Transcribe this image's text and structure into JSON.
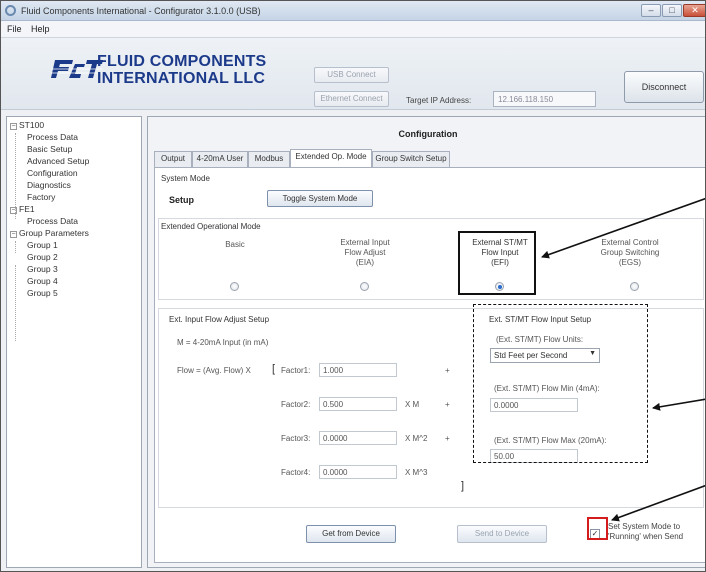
{
  "window": {
    "title": "Fluid Components International - Configurator 3.1.0.0 (USB)",
    "minimize_glyph": "–",
    "maximize_glyph": "□",
    "close_glyph": "✕"
  },
  "menu": {
    "items": [
      "File",
      "Help"
    ]
  },
  "header": {
    "logo_line1": "FLUID COMPONENTS",
    "logo_line2": "INTERNATIONAL LLC",
    "usb_connect": "USB Connect",
    "ethernet_connect": "Ethernet Connect",
    "target_ip_label": "Target IP Address:",
    "target_ip_value": "12.166.118.150",
    "disconnect": "Disconnect"
  },
  "tree": {
    "items": [
      {
        "label": "ST100",
        "expander": "−"
      },
      {
        "label": "Process Data"
      },
      {
        "label": "Basic Setup"
      },
      {
        "label": "Advanced Setup"
      },
      {
        "label": "Configuration"
      },
      {
        "label": "Diagnostics"
      },
      {
        "label": "Factory"
      },
      {
        "label": "FE1",
        "expander": "−"
      },
      {
        "label": "Process Data"
      },
      {
        "label": "Group Parameters",
        "expander": "−"
      },
      {
        "label": "Group 1"
      },
      {
        "label": "Group 2"
      },
      {
        "label": "Group 3"
      },
      {
        "label": "Group 4"
      },
      {
        "label": "Group 5"
      }
    ]
  },
  "config": {
    "title": "Configuration",
    "tabs": [
      "Output",
      "4-20mA User",
      "Modbus",
      "Extended Op. Mode",
      "Group Switch Setup"
    ],
    "active_tab": "Extended Op. Mode",
    "system_mode": {
      "group_label": "System Mode",
      "value": "Setup",
      "toggle_button": "Toggle System Mode"
    },
    "ext_op_mode": {
      "group_label": "Extended Operational Mode",
      "options": [
        {
          "line1": "Basic",
          "line2": "",
          "line3": "",
          "selected": false
        },
        {
          "line1": "External Input",
          "line2": "Flow Adjust",
          "line3": "(EIA)",
          "selected": false
        },
        {
          "line1": "External ST/MT",
          "line2": "Flow Input",
          "line3": "(EFI)",
          "selected": true
        },
        {
          "line1": "External Control",
          "line2": "Group Switching",
          "line3": "(EGS)",
          "selected": false
        }
      ]
    },
    "eia_setup": {
      "group_label": "Ext. Input Flow Adjust Setup",
      "m_formula": "M = 4-20mA Input (in mA)",
      "flow_formula": "Flow = (Avg. Flow) X",
      "open_bracket": "[",
      "close_bracket": "]",
      "factors": [
        {
          "label": "Factor1:",
          "value": "1.000",
          "suffix": "",
          "op": "+"
        },
        {
          "label": "Factor2:",
          "value": "0.500",
          "suffix": "X M",
          "op": "+"
        },
        {
          "label": "Factor3:",
          "value": "0.0000",
          "suffix": "X M^2",
          "op": "+"
        },
        {
          "label": "Factor4:",
          "value": "0.0000",
          "suffix": "X M^3",
          "op": ""
        }
      ]
    },
    "efi_setup": {
      "group_label": "Ext. ST/MT Flow Input Setup",
      "units_label": "(Ext. ST/MT) Flow Units:",
      "units_value": "Std Feet per Second",
      "min_label": "(Ext. ST/MT) Flow Min (4mA):",
      "min_value": "0.0000",
      "max_label": "(Ext. ST/MT) Flow Max (20mA):",
      "max_value": "50.00"
    },
    "buttons": {
      "get_from_device": "Get from Device",
      "send_to_device": "Send to Device"
    },
    "running_checkbox": {
      "checked": true,
      "check_glyph": "✓",
      "label_line1": "Set System Mode to",
      "label_line2": "'Running' when Send"
    }
  },
  "colors": {
    "logo_blue": "#1c3a8a",
    "radio_selected": "#2b6bcc",
    "annotation_red": "#d41c1c"
  }
}
